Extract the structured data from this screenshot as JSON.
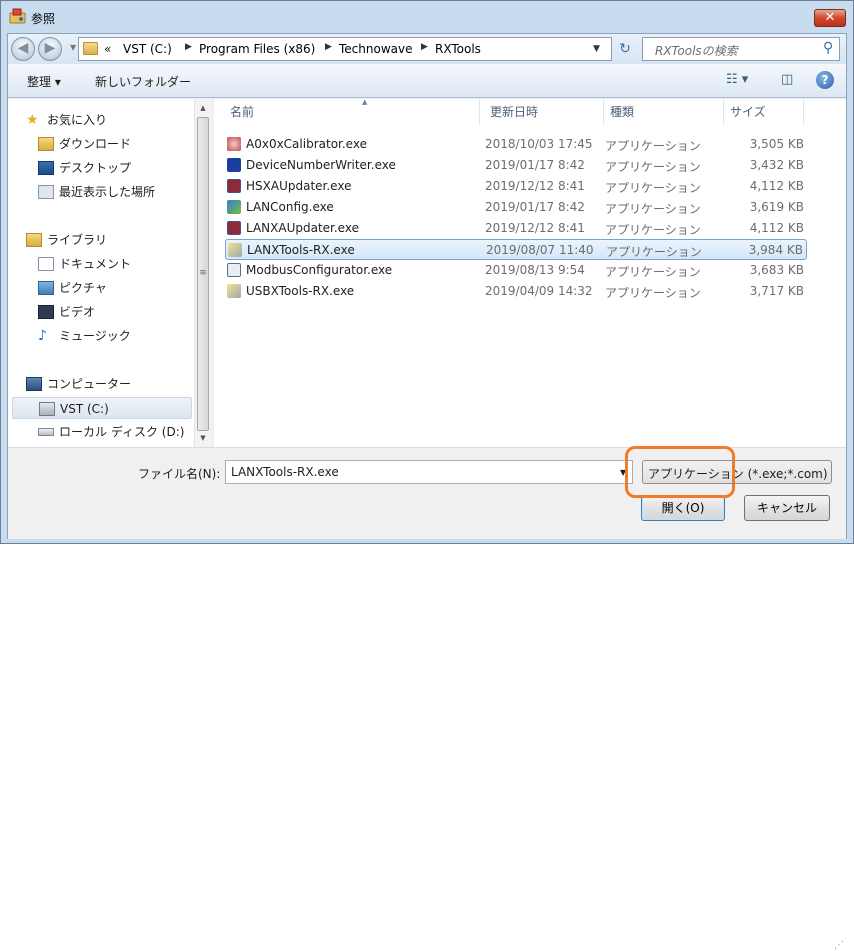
{
  "window": {
    "title": "参照",
    "close_label": "✕"
  },
  "address": {
    "prefix": "«",
    "crumbs": [
      "VST (C:)",
      "Program Files (x86)",
      "Technowave",
      "RXTools"
    ]
  },
  "search": {
    "placeholder": "RXToolsの検索"
  },
  "toolbar": {
    "organize": "整理 ▾",
    "new_folder": "新しいフォルダー"
  },
  "nav": {
    "favorites": "お気に入り",
    "downloads": "ダウンロード",
    "desktop": "デスクトップ",
    "recent": "最近表示した場所",
    "libraries": "ライブラリ",
    "documents": "ドキュメント",
    "pictures": "ピクチャ",
    "videos": "ビデオ",
    "music": "ミュージック",
    "computer": "コンピューター",
    "drive_c": "VST (C:)",
    "drive_d": "ローカル ディスク (D:)"
  },
  "columns": {
    "name": "名前",
    "date": "更新日時",
    "type": "種類",
    "size": "サイズ"
  },
  "files": [
    {
      "name": "A0x0xCalibrator.exe",
      "date": "2018/10/03 17:45",
      "type": "アプリケーション",
      "size": "3,505 KB"
    },
    {
      "name": "DeviceNumberWriter.exe",
      "date": "2019/01/17 8:42",
      "type": "アプリケーション",
      "size": "3,432 KB"
    },
    {
      "name": "HSXAUpdater.exe",
      "date": "2019/12/12 8:41",
      "type": "アプリケーション",
      "size": "4,112 KB"
    },
    {
      "name": "LANConfig.exe",
      "date": "2019/01/17 8:42",
      "type": "アプリケーション",
      "size": "3,619 KB"
    },
    {
      "name": "LANXAUpdater.exe",
      "date": "2019/12/12 8:41",
      "type": "アプリケーション",
      "size": "4,112 KB"
    },
    {
      "name": "LANXTools-RX.exe",
      "date": "2019/08/07 11:40",
      "type": "アプリケーション",
      "size": "3,984 KB"
    },
    {
      "name": "ModbusConfigurator.exe",
      "date": "2019/08/13 9:54",
      "type": "アプリケーション",
      "size": "3,683 KB"
    },
    {
      "name": "USBXTools-RX.exe",
      "date": "2019/04/09 14:32",
      "type": "アプリケーション",
      "size": "3,717 KB"
    }
  ],
  "selected_index": 5,
  "filename": {
    "label": "ファイル名(N):",
    "value": "LANXTools-RX.exe"
  },
  "filter": {
    "value": "アプリケーション (*.exe;*.com)"
  },
  "buttons": {
    "open": "開く(O)",
    "cancel": "キャンセル"
  },
  "colors": {
    "highlight": "#f07b28",
    "selection_border": "#7da2ce"
  }
}
